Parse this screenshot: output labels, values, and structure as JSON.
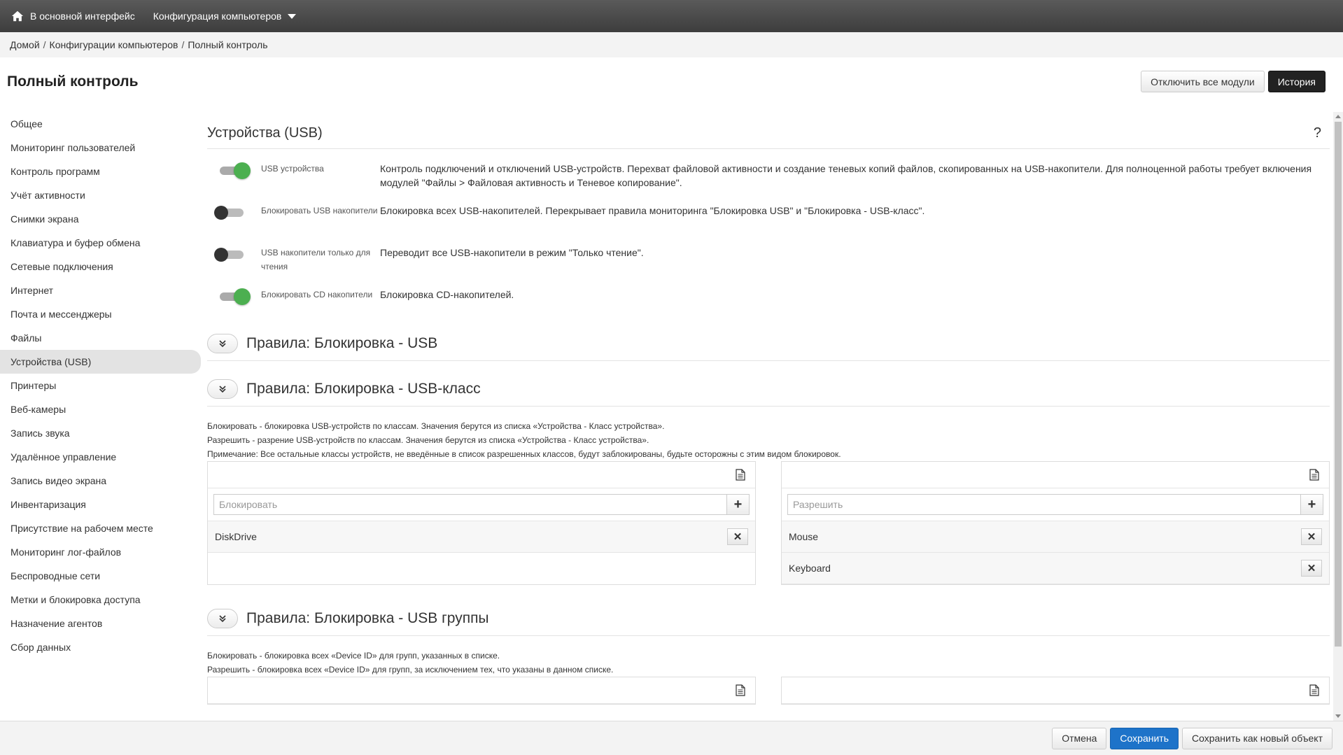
{
  "topbar": {
    "home_label": "В основной интерфейс",
    "menu_label": "Конфигурация компьютеров"
  },
  "breadcrumb": {
    "items": [
      "Домой",
      "Конфигурации компьютеров",
      "Полный контроль"
    ]
  },
  "page": {
    "title": "Полный контроль",
    "disable_all_label": "Отключить все модули",
    "history_label": "История"
  },
  "sidebar": {
    "active_index": 10,
    "items": [
      {
        "label": "Общее"
      },
      {
        "label": "Мониторинг пользователей"
      },
      {
        "label": "Контроль программ"
      },
      {
        "label": "Учёт активности"
      },
      {
        "label": "Снимки экрана"
      },
      {
        "label": "Клавиатура и буфер обмена"
      },
      {
        "label": "Сетевые подключения"
      },
      {
        "label": "Интернет"
      },
      {
        "label": "Почта и мессенджеры"
      },
      {
        "label": "Файлы"
      },
      {
        "label": "Устройства (USB)"
      },
      {
        "label": "Принтеры"
      },
      {
        "label": "Веб-камеры"
      },
      {
        "label": "Запись звука"
      },
      {
        "label": "Удалённое управление"
      },
      {
        "label": "Запись видео экрана"
      },
      {
        "label": "Инвентаризация"
      },
      {
        "label": "Присутствие на рабочем месте"
      },
      {
        "label": "Мониторинг лог-файлов"
      },
      {
        "label": "Беспроводные сети"
      },
      {
        "label": "Метки и блокировка доступа"
      },
      {
        "label": "Назначение агентов"
      },
      {
        "label": "Сбор данных"
      }
    ]
  },
  "main": {
    "section_title": "Устройства (USB)",
    "help_label": "?",
    "toggles": [
      {
        "label": "USB устройства",
        "on": true,
        "description": "Контроль подключений и отключений USB-устройств. Перехват файловой активности и создание теневых копий файлов, скопированных на USB-накопители. Для полноценной работы требует включения модулей \"Файлы > Файловая активность и Теневое копирование\"."
      },
      {
        "label": "Блокировать USB накопители",
        "on": false,
        "description": "Блокировка всех USB-накопителей. Перекрывает правила мониторинга \"Блокировка USB\" и \"Блокировка - USB-класс\"."
      },
      {
        "label": "USB накопители только для чтения",
        "on": false,
        "description": "Переводит все USB-накопители в режим \"Только чтение\"."
      },
      {
        "label": "Блокировать CD накопители",
        "on": true,
        "description": "Блокировка CD-накопителей."
      }
    ],
    "rules_usb": {
      "title": "Правила: Блокировка - USB"
    },
    "rules_usb_class": {
      "title": "Правила: Блокировка - USB-класс",
      "notes": [
        "Блокировать - блокировка USB-устройств по классам. Значения берутся из списка «Устройства - Класс устройства».",
        "Разрешить - разрение USB-устройств по классам. Значения берутся из списка «Устройства - Класс устройства».",
        "Примечание: Все остальные классы устройств, не введённые в список разрешенных классов, будут заблокированы, будьте осторожны с этим видом блокировок."
      ],
      "block_placeholder": "Блокировать",
      "allow_placeholder": "Разрешить",
      "block_items": [
        "DiskDrive"
      ],
      "allow_items": [
        "Mouse",
        "Keyboard"
      ]
    },
    "rules_usb_groups": {
      "title": "Правила: Блокировка - USB группы",
      "notes": [
        "Блокировать - блокировка всех «Device ID» для групп, указанных в списке.",
        "Разрешить - блокировка всех «Device ID» для групп, за исключением тех, что указаны в данном списке."
      ]
    },
    "add_symbol": "+",
    "remove_symbol": "✕"
  },
  "footer": {
    "cancel_label": "Отмена",
    "save_label": "Сохранить",
    "save_new_label": "Сохранить как новый объект"
  },
  "colors": {
    "toggle_on": "#4caf50",
    "primary": "#1e73c9",
    "dark_button": "#222222"
  },
  "icons": {
    "home": "home-icon",
    "menu_caret": "caret-down-icon",
    "expand": "double-chevron-down-icon",
    "document": "document-icon",
    "add": "plus-icon",
    "remove": "close-icon"
  }
}
